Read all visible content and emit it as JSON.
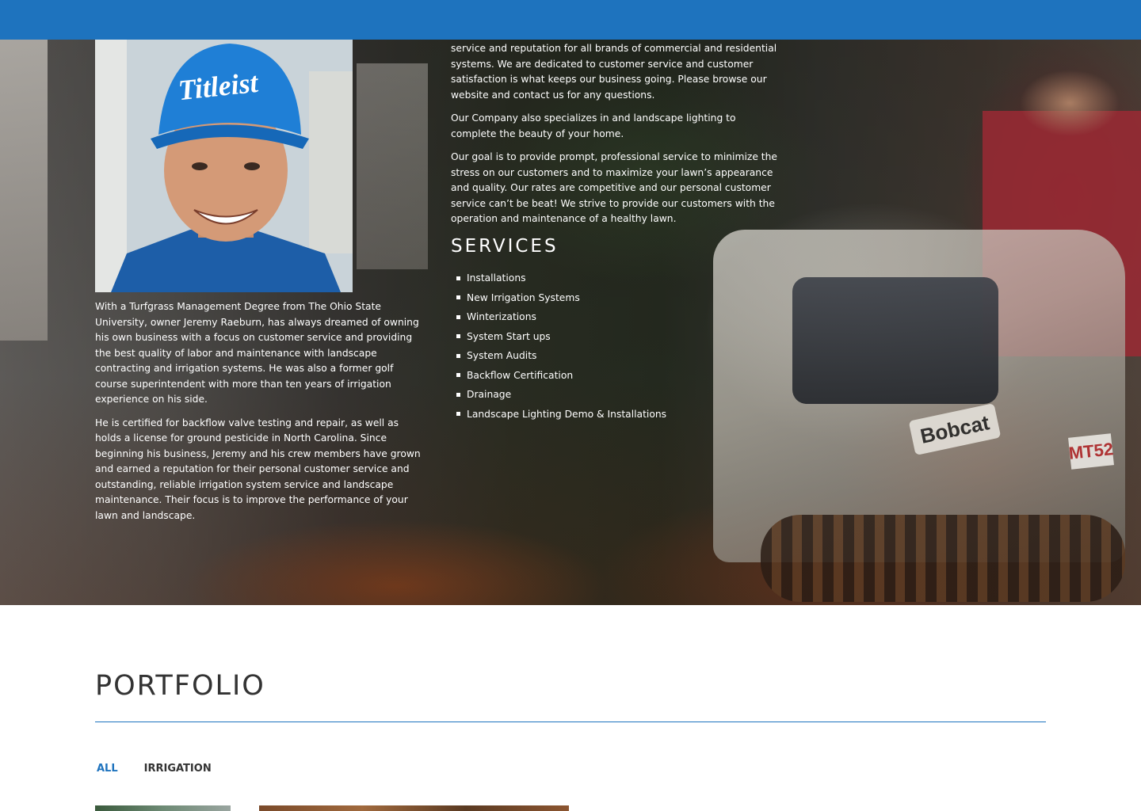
{
  "header": {
    "bar_color": "#1e73be"
  },
  "hero": {
    "machine_logo": "Bobcat",
    "machine_code": "MT52",
    "cap_logo": "Titleist",
    "portrait_alt": "owner-portrait"
  },
  "bio": {
    "paragraph_1": "With a Turfgrass Management Degree from The Ohio State University, owner Jeremy Raeburn, has always dreamed of owning his own business with a focus on customer service and providing the best quality of labor and maintenance with landscape contracting and irrigation systems. He was also a former golf course superintendent with more than ten years of irrigation experience on his side.",
    "paragraph_2": "He is certified for backflow valve testing and repair, as well as holds a license for ground pesticide in North Carolina. Since beginning his business, Jeremy and his crew members have grown and earned a reputation for their personal customer service and outstanding, reliable irrigation system service and landscape maintenance. Their focus is to improve the performance of your lawn and landscape."
  },
  "about": {
    "paragraph_1": "service and reputation for all brands of commercial and residential systems. We are dedicated to customer service and customer satisfaction is what keeps our business going. Please browse our website and contact us for any questions.",
    "paragraph_2": "Our Company also specializes in and landscape lighting to complete the beauty of your home.",
    "paragraph_3": "Our goal is to provide prompt, professional service to minimize the stress on our customers and to maximize your lawn’s appearance and quality. Our rates are competitive and our personal customer service can’t be beat! We strive to provide our customers with the operation and maintenance of a healthy lawn."
  },
  "services": {
    "title": "SERVICES",
    "items": [
      "Installations",
      "New Irrigation Systems",
      "Winterizations",
      "System Start ups",
      "System Audits",
      "Backflow Certification",
      "Drainage",
      "Landscape Lighting Demo & Installations"
    ]
  },
  "portfolio": {
    "title": "PORTFOLIO",
    "accent_color": "#1e73be",
    "filters": [
      "ALL",
      "IRRIGATION"
    ],
    "active_filter": "ALL"
  }
}
